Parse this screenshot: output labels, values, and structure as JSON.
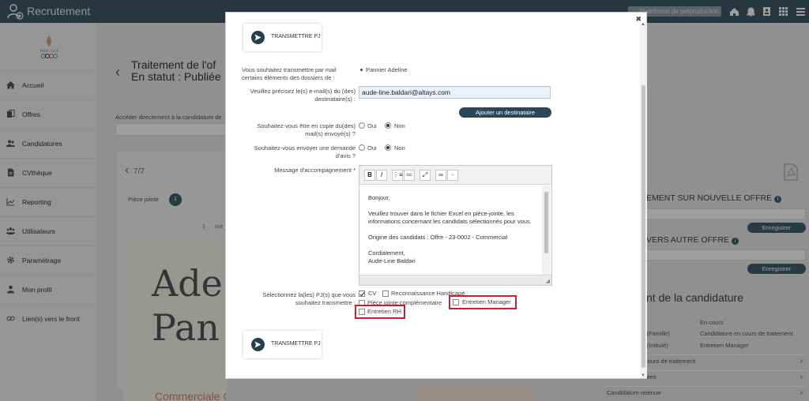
{
  "app": {
    "title": "Recrutement",
    "search_placeholder": "Plateforme de préproduction"
  },
  "sidebar": {
    "items": [
      {
        "label": "Accueil",
        "icon": "home-icon"
      },
      {
        "label": "Offres",
        "icon": "copy-icon"
      },
      {
        "label": "Candidatures",
        "icon": "users-icon"
      },
      {
        "label": "CVthèque",
        "icon": "file-icon"
      },
      {
        "label": "Reporting",
        "icon": "chart-icon"
      },
      {
        "label": "Utilisateurs",
        "icon": "group-icon"
      },
      {
        "label": "Paramétrage",
        "icon": "gear-icon"
      },
      {
        "label": "Mon profil",
        "icon": "user-icon"
      },
      {
        "label": "Lien(s) vers le front",
        "icon": "link-icon"
      }
    ]
  },
  "background": {
    "title_line1": "Traitement de l'of",
    "title_line2": "En statut : Publiée",
    "access_label": "Accéder directement à la candidature de",
    "pager": "7/7",
    "pj_label": "Pièce jointe",
    "pj_count": "1",
    "page_number": "1",
    "page_of": "sur",
    "doc_line1": "Ade",
    "doc_line2": "Pan",
    "doc_subtitle": "Commerciale Grands Comptes",
    "right": {
      "head1": "EMENT SUR NOUVELLE OFFRE",
      "head2": "VERS AUTRE OFFRE",
      "save_label": "Enregistrer",
      "big": "nt de la candidature",
      "status_value": "En cours",
      "famille_label": "ote (Famille)",
      "famille_value": "Candidature en cours de traitement",
      "intitule_label": "ote (Intitulé)",
      "intitule_value": "Entretien Manager",
      "bar1": "cours de traitement",
      "bar2": "rées",
      "bar3": "Candidature retenue"
    }
  },
  "modal": {
    "transmit_label": "TRANSMETTRE PJ",
    "q_transmit": "Vous souhaitez transmettre par mail certains éléments des dossiers de :",
    "candidate": "Pannier Adeline",
    "q_emails": "Veuillez précisez le(s) e-mail(s) du (des) destinataire(s) :",
    "email_value": "aude-line.baldari@altays.com",
    "add_recipient": "Ajouter un destinataire",
    "q_copy": "Souhaitez-vous être en copie du(des) mail(s) envoyé(s) ?",
    "q_review": "Souhaitez-vous envoyer une demande d'avis ?",
    "oui": "Oui",
    "non": "Non",
    "message_label": "Message d'accompagnement *",
    "message": {
      "l1": "Bonjour,",
      "l2": "Veuillez trouver dans le fichier Excel en pièce-jointe, les",
      "l3": "informations concernant les candidats sélectionnés pour vous.",
      "l4": "Origine des candidats : Offre - 23-0002 - Commercial",
      "l5": "Cordialement,",
      "l6": "Aude-Line Baldari"
    },
    "q_pj": "Sélectionnez la(les) PJ(s) que vous souhaitez transmettre :",
    "pj_options": {
      "cv": "CV",
      "handicap": "Reconnaissance Handicapé",
      "complement": "Pièce jointe complémentaire",
      "manager": "Entretien Manager",
      "rh": "Entretien RH"
    }
  },
  "colors": {
    "topbar": "#405a66",
    "accent": "#2b4757",
    "highlight": "#c7202e"
  }
}
